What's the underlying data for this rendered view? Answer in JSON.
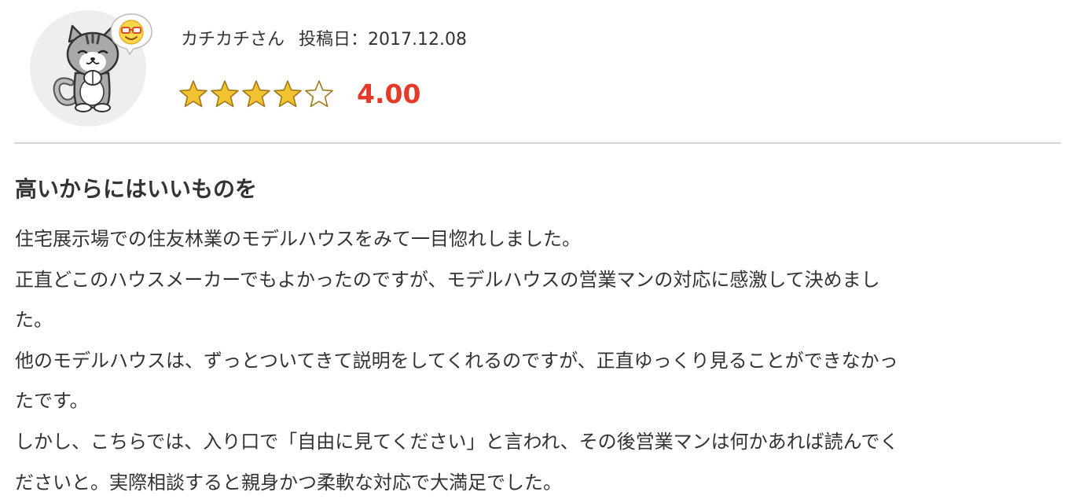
{
  "reviewer": {
    "name": "カチカチさん",
    "avatar": "cat-avatar-icon",
    "mood": "smiley-glasses-icon"
  },
  "post": {
    "date_label": "投稿日：2017.12.08"
  },
  "rating": {
    "value_text": "4.00",
    "value": 4.0,
    "max": 5,
    "star_color": "#f2c230",
    "value_color": "#e33b28"
  },
  "review": {
    "title": "高いからにはいいものを",
    "lines": [
      "住宅展示場での住友林業のモデルハウスをみて一目惚れしました。",
      "正直どこのハウスメーカーでもよかったのですが、モデルハウスの営業マンの対応に感激して決めまし",
      "た。",
      "他のモデルハウスは、ずっとついてきて説明をしてくれるのですが、正直ゆっくり見ることができなかっ",
      "たです。",
      "しかし、こちらでは、入り口で「自由に見てください」と言われ、その後営業マンは何かあれば読んでく",
      "ださいと。実際相談すると親身かつ柔軟な対応で大満足でした。"
    ]
  }
}
